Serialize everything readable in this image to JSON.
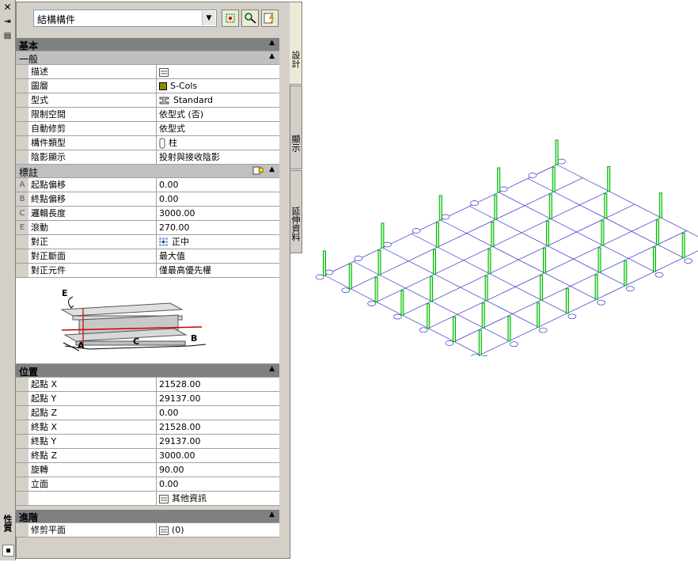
{
  "palette": {
    "title": "性質"
  },
  "toolbar": {
    "type": "結構構件"
  },
  "tabs": [
    "設計",
    "顯示",
    "延伸資料"
  ],
  "sections": {
    "basic": "基本",
    "general": "一般",
    "annotation": "標註",
    "location": "位置",
    "advanced": "進階"
  },
  "general": [
    {
      "name": "描述",
      "value": ""
    },
    {
      "name": "圖層",
      "value": "S-Cols"
    },
    {
      "name": "型式",
      "value": "Standard"
    },
    {
      "name": "限制空間",
      "value": "依型式 (否)"
    },
    {
      "name": "自動修剪",
      "value": "依型式"
    },
    {
      "name": "構件類型",
      "value": "柱"
    },
    {
      "name": "陰影顯示",
      "value": "投射與接收陰影"
    }
  ],
  "annotation": [
    {
      "letter": "A",
      "name": "起點偏移",
      "value": "0.00"
    },
    {
      "letter": "B",
      "name": "終點偏移",
      "value": "0.00"
    },
    {
      "letter": "C",
      "name": "邏輯長度",
      "value": "3000.00"
    },
    {
      "letter": "E",
      "name": "滾動",
      "value": "270.00"
    },
    {
      "letter": "",
      "name": "對正",
      "value": "正中"
    },
    {
      "letter": "",
      "name": "對正斷面",
      "value": "最大值"
    },
    {
      "letter": "",
      "name": "對正元件",
      "value": "僅最高優先權"
    }
  ],
  "diagram_labels": {
    "a": "A",
    "b": "B",
    "c": "C",
    "e": "E"
  },
  "location": [
    {
      "name": "起點 X",
      "value": "21528.00"
    },
    {
      "name": "起點 Y",
      "value": "29137.00"
    },
    {
      "name": "起點 Z",
      "value": "0.00"
    },
    {
      "name": "終點 X",
      "value": "21528.00"
    },
    {
      "name": "終點 Y",
      "value": "29137.00"
    },
    {
      "name": "終點 Z",
      "value": "3000.00"
    },
    {
      "name": "旋轉",
      "value": "90.00"
    },
    {
      "name": "立面",
      "value": "0.00"
    },
    {
      "name": "",
      "value": "其他資訊"
    }
  ],
  "advanced": [
    {
      "name": "修剪平面",
      "value": "(0)"
    }
  ],
  "colors": {
    "layer_swatch": "#8b8b00",
    "grid": "#3333cc",
    "column": "#00aa00"
  }
}
